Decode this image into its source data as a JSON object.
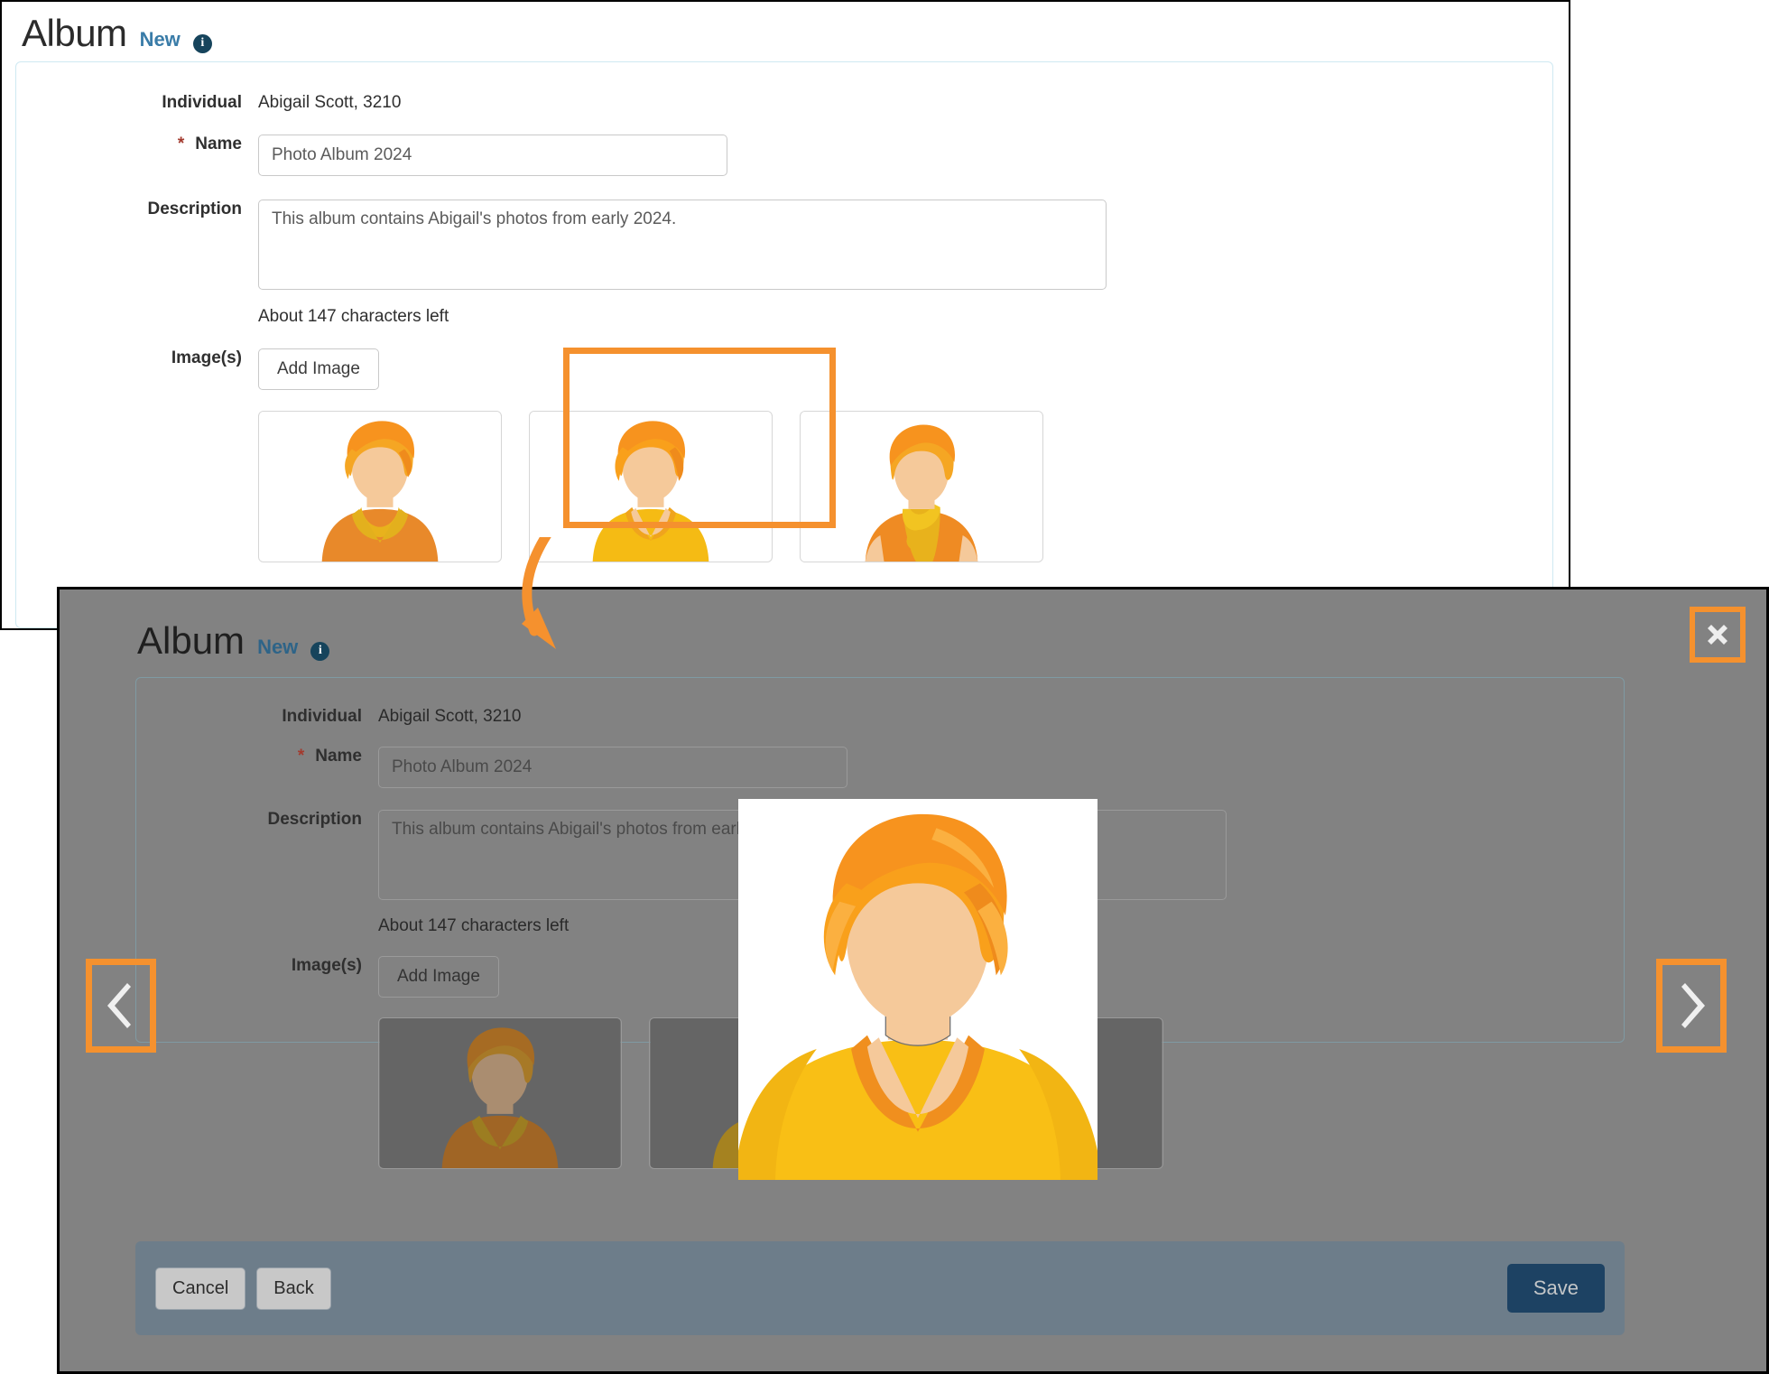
{
  "base_form": {
    "title": "Album",
    "subtitle": "New",
    "info_icon": "info-icon",
    "fields": {
      "individual_label": "Individual",
      "individual_value": "Abigail Scott, 3210",
      "name_label": "Name",
      "name_required_marker": "*",
      "name_value": "Photo Album 2024",
      "name_placeholder": "Name",
      "description_label": "Description",
      "description_value": "This album contains Abigail's photos from early 2024.",
      "description_placeholder": "Description",
      "characters_left": "About 147 characters left",
      "images_label": "Image(s)",
      "add_image_label": "Add Image"
    },
    "thumbnails": [
      {
        "alt": "portrait-orange-jacket",
        "selected": false
      },
      {
        "alt": "portrait-yellow-vneck",
        "selected": true
      },
      {
        "alt": "portrait-yellow-scarf",
        "selected": false
      }
    ]
  },
  "modal": {
    "title": "Album",
    "subtitle": "New",
    "info_icon": "info-icon",
    "close_label": "✕",
    "prev_label": "‹",
    "next_label": "›",
    "fields": {
      "individual_label": "Individual",
      "individual_value": "Abigail Scott, 3210",
      "name_label": "Name",
      "name_required_marker": "*",
      "name_value": "Photo Album 2024",
      "description_label": "Description",
      "description_value": "This album contains Abigail's photos from early 2024.",
      "characters_left": "About 147 characters left",
      "images_label": "Image(s)",
      "add_image_label": "Add Image"
    },
    "thumbnails": [
      {
        "alt": "portrait-orange-jacket"
      },
      {
        "alt": "portrait-yellow-vneck"
      },
      {
        "alt": "portrait-yellow-scarf"
      }
    ],
    "footer": {
      "cancel_label": "Cancel",
      "back_label": "Back",
      "save_label": "Save"
    },
    "preview": {
      "alt": "portrait-yellow-vneck-large"
    }
  },
  "annotations": {
    "highlight_color": "#f5912e",
    "arrow_name": "callout-arrow"
  },
  "colors": {
    "accent_orange": "#f5912e",
    "link_blue": "#3a7ca8",
    "save_blue": "#1d4263",
    "overlay_gray": "#828282",
    "footer_gray": "#6d7d8a",
    "required_red": "#a33a2e"
  }
}
